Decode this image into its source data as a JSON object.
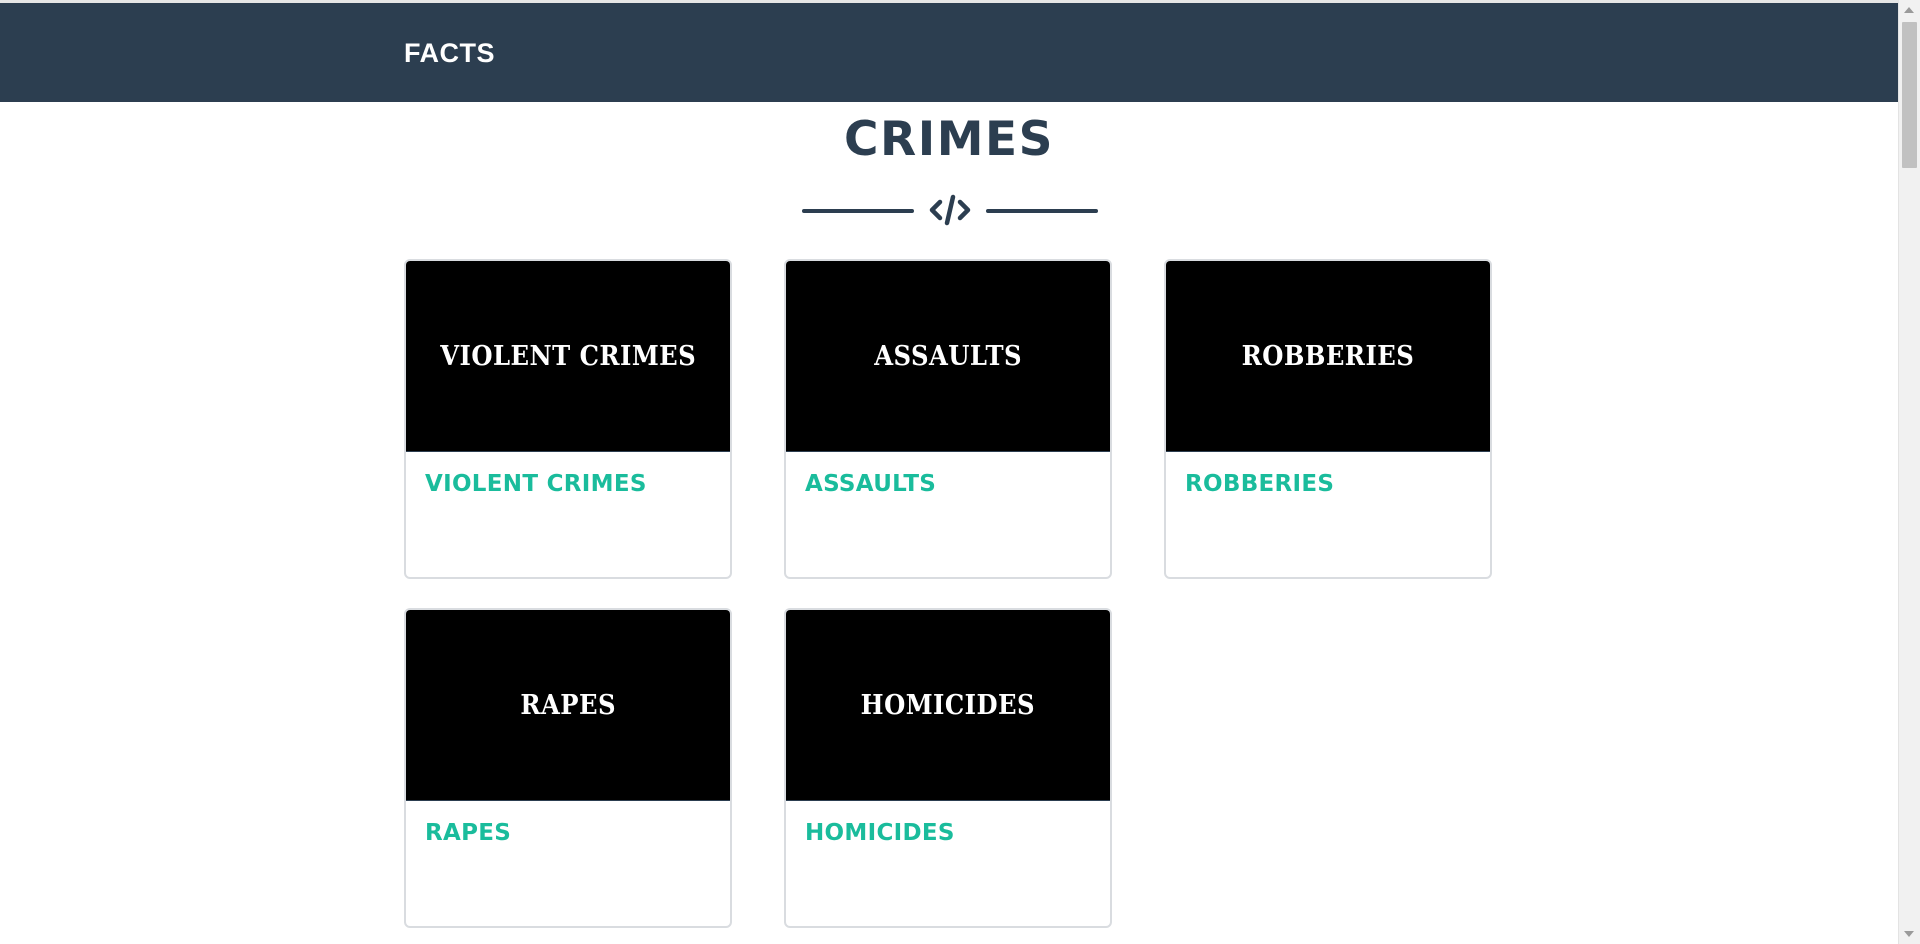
{
  "navbar": {
    "brand": "FACTS",
    "background_color": "#2c3e50"
  },
  "section": {
    "title": "CRIMES",
    "divider_icon": "code-icon"
  },
  "cards": [
    {
      "image_text": "VIOLENT CRIMES",
      "title": "VIOLENT CRIMES"
    },
    {
      "image_text": "ASSAULTS",
      "title": "ASSAULTS"
    },
    {
      "image_text": "ROBBERIES",
      "title": "ROBBERIES"
    },
    {
      "image_text": "RAPES",
      "title": "RAPES"
    },
    {
      "image_text": "HOMICIDES",
      "title": "HOMICIDES"
    }
  ],
  "colors": {
    "primary": "#2c3e50",
    "accent": "#1abc9c",
    "card_image_bg": "#000000"
  }
}
